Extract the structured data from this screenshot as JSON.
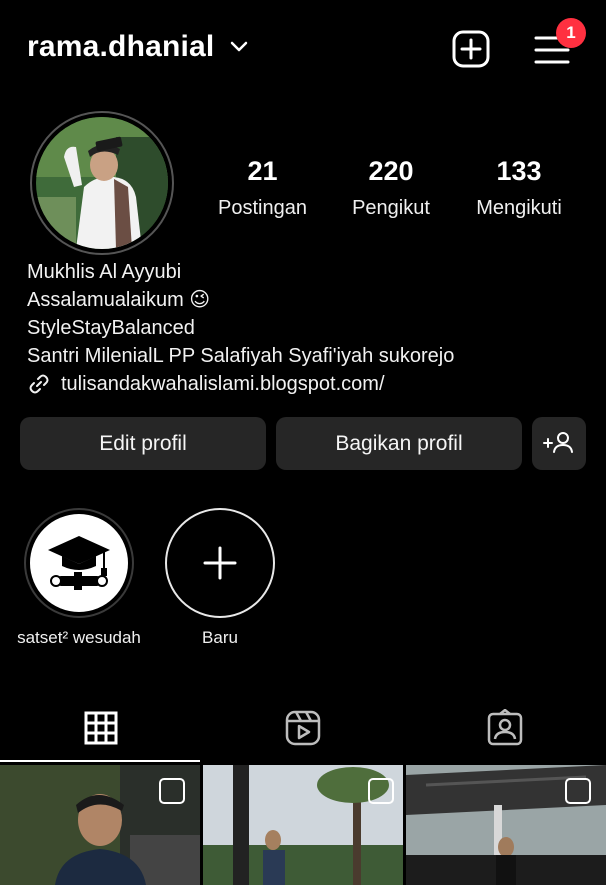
{
  "header": {
    "username": "rama.dhanial",
    "notification_count": "1"
  },
  "profile": {
    "stats": [
      {
        "value": "21",
        "label": "Postingan"
      },
      {
        "value": "220",
        "label": "Pengikut"
      },
      {
        "value": "133",
        "label": "Mengikuti"
      }
    ],
    "bio": {
      "name": "Mukhlis Al Ayyubi",
      "line1": "Assalamualaikum 😉",
      "line2": "StyleStayBalanced",
      "line3": "Santri MilenialL PP Salafiyah Syafi'iyah sukorejo",
      "link": "tulisandakwahalislami.blogspot.com/"
    }
  },
  "actions": {
    "edit_label": "Edit profil",
    "share_label": "Bagikan profil"
  },
  "highlights": [
    {
      "label": "satset² wesudah",
      "icon": "graduation-cap-icon"
    },
    {
      "label": "Baru",
      "icon": "plus-icon"
    }
  ],
  "tabs": [
    {
      "icon": "grid-icon",
      "active": true
    },
    {
      "icon": "reels-icon",
      "active": false
    },
    {
      "icon": "tagged-icon",
      "active": false
    }
  ],
  "colors": {
    "background": "#000000",
    "button": "#262626",
    "badge": "#ff3040"
  }
}
